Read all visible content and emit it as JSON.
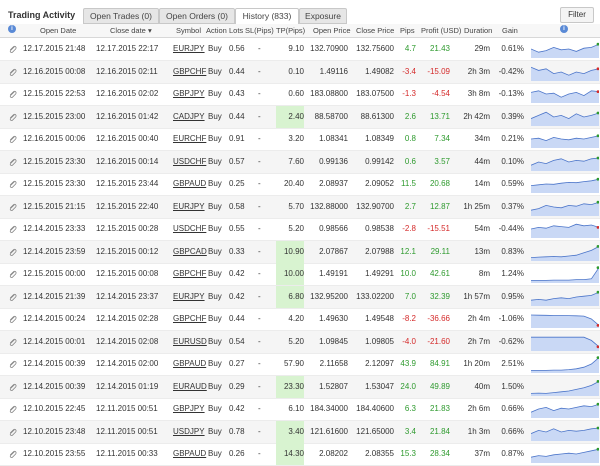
{
  "header": {
    "title": "Trading Activity",
    "tabs": [
      "Open Trades (0)",
      "Open Orders (0)",
      "History (833)",
      "Exposure"
    ],
    "filter_label": "Filter"
  },
  "columns": {
    "open_date": "Open Date",
    "close_date": "Close date ▾",
    "symbol": "Symbol",
    "action": "Action",
    "lots": "Lots",
    "sl": "SL(Pips)",
    "tp": "TP(Pips)",
    "open_price": "Open Price",
    "close_price": "Close Price",
    "pips": "Pips",
    "profit": "Profit (USD)",
    "duration": "Duration",
    "gain": "Gain"
  },
  "colors": {
    "positive": "#2e9a2e",
    "negative": "#d42a2a",
    "tp_highlight": "#d8f3d0",
    "spark_fill": "#c9d8f5",
    "spark_line": "#4a74c9"
  },
  "rows": [
    {
      "open": "12.17.2015 21:48",
      "close": "12.17.2015 22:17",
      "symbol": "EURJPY",
      "action": "Buy",
      "lots": "0.56",
      "sl": "-",
      "tp": "9.10",
      "open_price": "132.70900",
      "close_price": "132.75600",
      "pips": "4.7",
      "profit": "21.43",
      "duration": "29m",
      "gain": "0.61%",
      "tp_hl": false,
      "spark": [
        0.5,
        0.3,
        0.4,
        0.6,
        0.45,
        0.5,
        0.35,
        0.55,
        0.6,
        0.8
      ]
    },
    {
      "open": "12.16.2015 00:08",
      "close": "12.16.2015 02:11",
      "symbol": "GBPCHF",
      "action": "Buy",
      "lots": "0.44",
      "sl": "-",
      "tp": "0.10",
      "open_price": "1.49116",
      "close_price": "1.49082",
      "pips": "-3.4",
      "profit": "-15.09",
      "duration": "2h 3m",
      "gain": "-0.42%",
      "tp_hl": false,
      "spark": [
        0.8,
        0.6,
        0.7,
        0.4,
        0.5,
        0.3,
        0.5,
        0.4,
        0.6,
        0.7
      ]
    },
    {
      "open": "12.15.2015 22:53",
      "close": "12.16.2015 02:02",
      "symbol": "GBPJPY",
      "action": "Buy",
      "lots": "0.43",
      "sl": "-",
      "tp": "0.60",
      "open_price": "183.08800",
      "close_price": "183.07500",
      "pips": "-1.3",
      "profit": "-4.54",
      "duration": "3h 8m",
      "gain": "-0.13%",
      "tp_hl": false,
      "spark": [
        0.6,
        0.7,
        0.5,
        0.55,
        0.3,
        0.5,
        0.6,
        0.4,
        0.7,
        0.65
      ]
    },
    {
      "open": "12.15.2015 23:00",
      "close": "12.16.2015 01:42",
      "symbol": "CADJPY",
      "action": "Buy",
      "lots": "0.44",
      "sl": "-",
      "tp": "2.40",
      "open_price": "88.58700",
      "close_price": "88.61300",
      "pips": "2.6",
      "profit": "13.71",
      "duration": "2h 42m",
      "gain": "0.39%",
      "tp_hl": true,
      "spark": [
        0.4,
        0.6,
        0.8,
        0.5,
        0.6,
        0.4,
        0.7,
        0.5,
        0.6,
        0.75
      ]
    },
    {
      "open": "12.16.2015 00:06",
      "close": "12.16.2015 00:40",
      "symbol": "EURCHF",
      "action": "Buy",
      "lots": "0.91",
      "sl": "-",
      "tp": "3.20",
      "open_price": "1.08341",
      "close_price": "1.08349",
      "pips": "0.8",
      "profit": "7.34",
      "duration": "34m",
      "gain": "0.21%",
      "tp_hl": false,
      "spark": [
        0.5,
        0.55,
        0.4,
        0.6,
        0.5,
        0.45,
        0.55,
        0.5,
        0.6,
        0.7
      ]
    },
    {
      "open": "12.15.2015 23:30",
      "close": "12.16.2015 00:14",
      "symbol": "USDCHF",
      "action": "Buy",
      "lots": "0.57",
      "sl": "-",
      "tp": "7.60",
      "open_price": "0.99136",
      "close_price": "0.99142",
      "pips": "0.6",
      "profit": "3.57",
      "duration": "44m",
      "gain": "0.10%",
      "tp_hl": false,
      "spark": [
        0.3,
        0.5,
        0.4,
        0.6,
        0.7,
        0.5,
        0.6,
        0.55,
        0.7,
        0.75
      ]
    },
    {
      "open": "12.15.2015 23:30",
      "close": "12.15.2015 23:44",
      "symbol": "GBPAUD",
      "action": "Buy",
      "lots": "0.25",
      "sl": "-",
      "tp": "20.40",
      "open_price": "2.08937",
      "close_price": "2.09052",
      "pips": "11.5",
      "profit": "20.68",
      "duration": "14m",
      "gain": "0.59%",
      "tp_hl": false,
      "spark": [
        0.4,
        0.45,
        0.5,
        0.48,
        0.55,
        0.6,
        0.58,
        0.65,
        0.7,
        0.8
      ]
    },
    {
      "open": "12.15.2015 21:15",
      "close": "12.15.2015 22:40",
      "symbol": "EURJPY",
      "action": "Buy",
      "lots": "0.58",
      "sl": "-",
      "tp": "5.70",
      "open_price": "132.88000",
      "close_price": "132.90700",
      "pips": "2.7",
      "profit": "12.87",
      "duration": "1h 25m",
      "gain": "0.37%",
      "tp_hl": false,
      "spark": [
        0.3,
        0.4,
        0.6,
        0.5,
        0.45,
        0.6,
        0.55,
        0.7,
        0.65,
        0.8
      ]
    },
    {
      "open": "12.14.2015 23:33",
      "close": "12.15.2015 00:28",
      "symbol": "USDCHF",
      "action": "Buy",
      "lots": "0.55",
      "sl": "-",
      "tp": "5.20",
      "open_price": "0.98566",
      "close_price": "0.98538",
      "pips": "-2.8",
      "profit": "-15.51",
      "duration": "54m",
      "gain": "-0.44%",
      "tp_hl": false,
      "spark": [
        0.5,
        0.6,
        0.55,
        0.7,
        0.65,
        0.6,
        0.8,
        0.7,
        0.75,
        0.6
      ]
    },
    {
      "open": "12.14.2015 23:59",
      "close": "12.15.2015 00:12",
      "symbol": "GBPCAD",
      "action": "Buy",
      "lots": "0.33",
      "sl": "-",
      "tp": "10.90",
      "open_price": "2.07867",
      "close_price": "2.07988",
      "pips": "12.1",
      "profit": "29.11",
      "duration": "13m",
      "gain": "0.83%",
      "tp_hl": true,
      "spark": [
        0.15,
        0.18,
        0.2,
        0.22,
        0.2,
        0.25,
        0.3,
        0.45,
        0.6,
        0.85
      ]
    },
    {
      "open": "12.15.2015 00:00",
      "close": "12.15.2015 00:08",
      "symbol": "GBPCHF",
      "action": "Buy",
      "lots": "0.42",
      "sl": "-",
      "tp": "10.00",
      "open_price": "1.49191",
      "close_price": "1.49291",
      "pips": "10.0",
      "profit": "42.61",
      "duration": "8m",
      "gain": "1.24%",
      "tp_hl": true,
      "spark": [
        0.1,
        0.1,
        0.1,
        0.12,
        0.12,
        0.12,
        0.15,
        0.15,
        0.2,
        0.9
      ]
    },
    {
      "open": "12.14.2015 21:39",
      "close": "12.14.2015 23:37",
      "symbol": "EURJPY",
      "action": "Buy",
      "lots": "0.42",
      "sl": "-",
      "tp": "6.80",
      "open_price": "132.95200",
      "close_price": "133.02200",
      "pips": "7.0",
      "profit": "32.39",
      "duration": "1h 57m",
      "gain": "0.95%",
      "tp_hl": true,
      "spark": [
        0.3,
        0.35,
        0.3,
        0.4,
        0.45,
        0.4,
        0.5,
        0.55,
        0.6,
        0.8
      ]
    },
    {
      "open": "12.14.2015 00:24",
      "close": "12.14.2015 02:28",
      "symbol": "GBPCHF",
      "action": "Buy",
      "lots": "0.44",
      "sl": "-",
      "tp": "4.20",
      "open_price": "1.49630",
      "close_price": "1.49548",
      "pips": "-8.2",
      "profit": "-36.66",
      "duration": "2h 4m",
      "gain": "-1.06%",
      "tp_hl": false,
      "spark": [
        0.75,
        0.74,
        0.73,
        0.72,
        0.72,
        0.71,
        0.7,
        0.68,
        0.5,
        0.1
      ]
    },
    {
      "open": "12.14.2015 00:01",
      "close": "12.14.2015 02:08",
      "symbol": "EURUSD",
      "action": "Buy",
      "lots": "0.54",
      "sl": "-",
      "tp": "5.20",
      "open_price": "1.09845",
      "close_price": "1.09805",
      "pips": "-4.0",
      "profit": "-21.60",
      "duration": "2h 7m",
      "gain": "-0.62%",
      "tp_hl": false,
      "spark": [
        0.8,
        0.8,
        0.8,
        0.8,
        0.8,
        0.8,
        0.8,
        0.8,
        0.6,
        0.2
      ]
    },
    {
      "open": "12.14.2015 00:39",
      "close": "12.14.2015 02:00",
      "symbol": "GBPAUD",
      "action": "Buy",
      "lots": "0.27",
      "sl": "-",
      "tp": "57.90",
      "open_price": "2.11658",
      "close_price": "2.12097",
      "pips": "43.9",
      "profit": "84.91",
      "duration": "1h 20m",
      "gain": "2.51%",
      "tp_hl": false,
      "spark": [
        0.1,
        0.1,
        0.1,
        0.12,
        0.12,
        0.15,
        0.2,
        0.3,
        0.5,
        0.9
      ]
    },
    {
      "open": "12.14.2015 00:39",
      "close": "12.14.2015 01:19",
      "symbol": "EURAUD",
      "action": "Buy",
      "lots": "0.29",
      "sl": "-",
      "tp": "23.30",
      "open_price": "1.52807",
      "close_price": "1.53047",
      "pips": "24.0",
      "profit": "49.89",
      "duration": "40m",
      "gain": "1.50%",
      "tp_hl": true,
      "spark": [
        0.1,
        0.12,
        0.1,
        0.15,
        0.2,
        0.25,
        0.35,
        0.45,
        0.6,
        0.85
      ]
    },
    {
      "open": "12.10.2015 22:45",
      "close": "12.11.2015 00:51",
      "symbol": "GBPJPY",
      "action": "Buy",
      "lots": "0.42",
      "sl": "-",
      "tp": "6.10",
      "open_price": "184.34000",
      "close_price": "184.40600",
      "pips": "6.3",
      "profit": "21.83",
      "duration": "2h 6m",
      "gain": "0.66%",
      "tp_hl": false,
      "spark": [
        0.3,
        0.5,
        0.6,
        0.4,
        0.55,
        0.5,
        0.6,
        0.7,
        0.65,
        0.8
      ]
    },
    {
      "open": "12.10.2015 23:48",
      "close": "12.11.2015 00:51",
      "symbol": "USDJPY",
      "action": "Buy",
      "lots": "0.78",
      "sl": "-",
      "tp": "3.40",
      "open_price": "121.61600",
      "close_price": "121.65000",
      "pips": "3.4",
      "profit": "21.84",
      "duration": "1h 3m",
      "gain": "0.66%",
      "tp_hl": true,
      "spark": [
        0.4,
        0.6,
        0.5,
        0.7,
        0.5,
        0.6,
        0.55,
        0.6,
        0.7,
        0.75
      ]
    },
    {
      "open": "12.10.2015 23:55",
      "close": "12.11.2015 00:33",
      "symbol": "GBPAUD",
      "action": "Buy",
      "lots": "0.26",
      "sl": "-",
      "tp": "14.30",
      "open_price": "2.08202",
      "close_price": "2.08355",
      "pips": "15.3",
      "profit": "28.34",
      "duration": "37m",
      "gain": "0.87%",
      "tp_hl": true,
      "spark": [
        0.3,
        0.4,
        0.35,
        0.45,
        0.5,
        0.55,
        0.5,
        0.6,
        0.7,
        0.8
      ]
    }
  ]
}
